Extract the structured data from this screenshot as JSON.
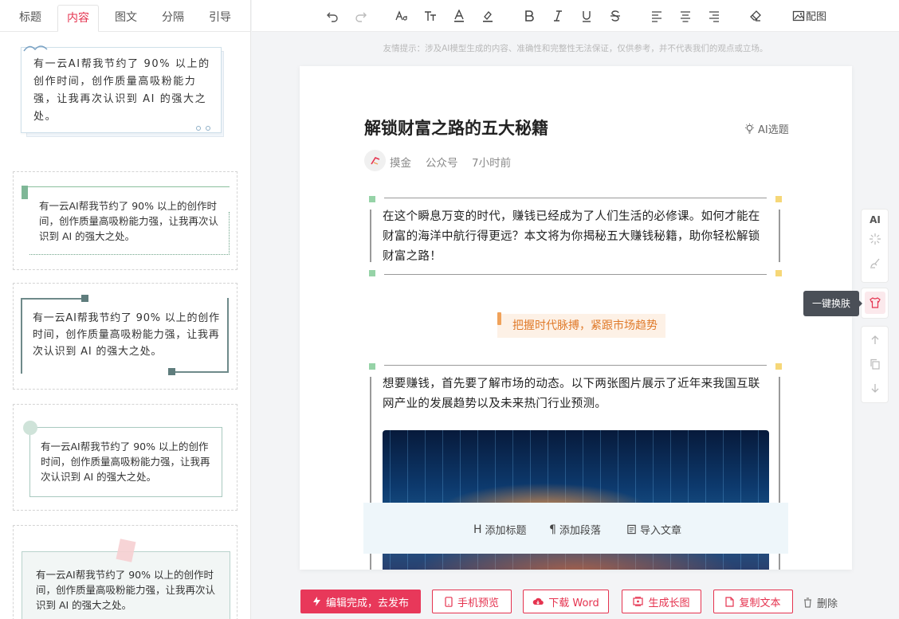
{
  "tabs": [
    "标题",
    "内容",
    "图文",
    "分隔",
    "引导"
  ],
  "active_tab": "内容",
  "templates": [
    {
      "text": "有一云AI帮我节约了 90% 以上的创作时间，创作质量高吸粉能力强，让我再次认识到 AI 的强大之处。"
    },
    {
      "text": "有一云AI帮我节约了 90% 以上的创作时间，创作质量高吸粉能力强，让我再次认识到 AI 的强大之处。"
    },
    {
      "text": "有一云AI帮我节约了 90% 以上的创作时间，创作质量高吸粉能力强，让我再次认识到 AI 的强大之处。"
    },
    {
      "text": "有一云AI帮我节约了 90% 以上的创作时间，创作质量高吸粉能力强，让我再次认识到 AI 的强大之处。"
    },
    {
      "text": "有一云AI帮我节约了 90% 以上的创作时间，创作质量高吸粉能力强，让我再次认识到 AI 的强大之处。"
    }
  ],
  "toolbar": {
    "image_label": "配图"
  },
  "notice": "友情提示：涉及AI模型生成的内容、准确性和完整性无法保证，仅供参考，并不代表我们的观点或立场。",
  "article": {
    "title": "解锁财富之路的五大秘籍",
    "ai_topic": "AI选题",
    "author": "摸金",
    "source": "公众号",
    "time": "7小时前",
    "para1": "在这个瞬息万变的时代，赚钱已经成为了人们生活的必修课。如何才能在财富的海洋中航行得更远？本文将为你揭秘五大赚钱秘籍，助你轻松解锁财富之路！",
    "subheading": "把握时代脉搏，紧跟市场趋势",
    "para2": "想要赚钱，首先要了解市场的动态。以下两张图片展示了近年来我国互联网产业的发展趋势以及未来热门行业预测。"
  },
  "addbar": {
    "add_heading": "添加标题",
    "add_paragraph": "添加段落",
    "import_article": "导入文章"
  },
  "rail": {
    "ai_label": "AI",
    "tooltip": "一键换肤"
  },
  "bottom": {
    "publish": "编辑完成，去发布",
    "mobile_preview": "手机预览",
    "download_word": "下载 Word",
    "long_image": "生成长图",
    "copy_text": "复制文本",
    "delete": "删除"
  },
  "colors": {
    "accent": "#e5334f",
    "subheading_bg": "#fdf1e6",
    "subheading_fg": "#e07a2a",
    "deco_green": "#96d3a7",
    "deco_yellow": "#f6d778"
  }
}
